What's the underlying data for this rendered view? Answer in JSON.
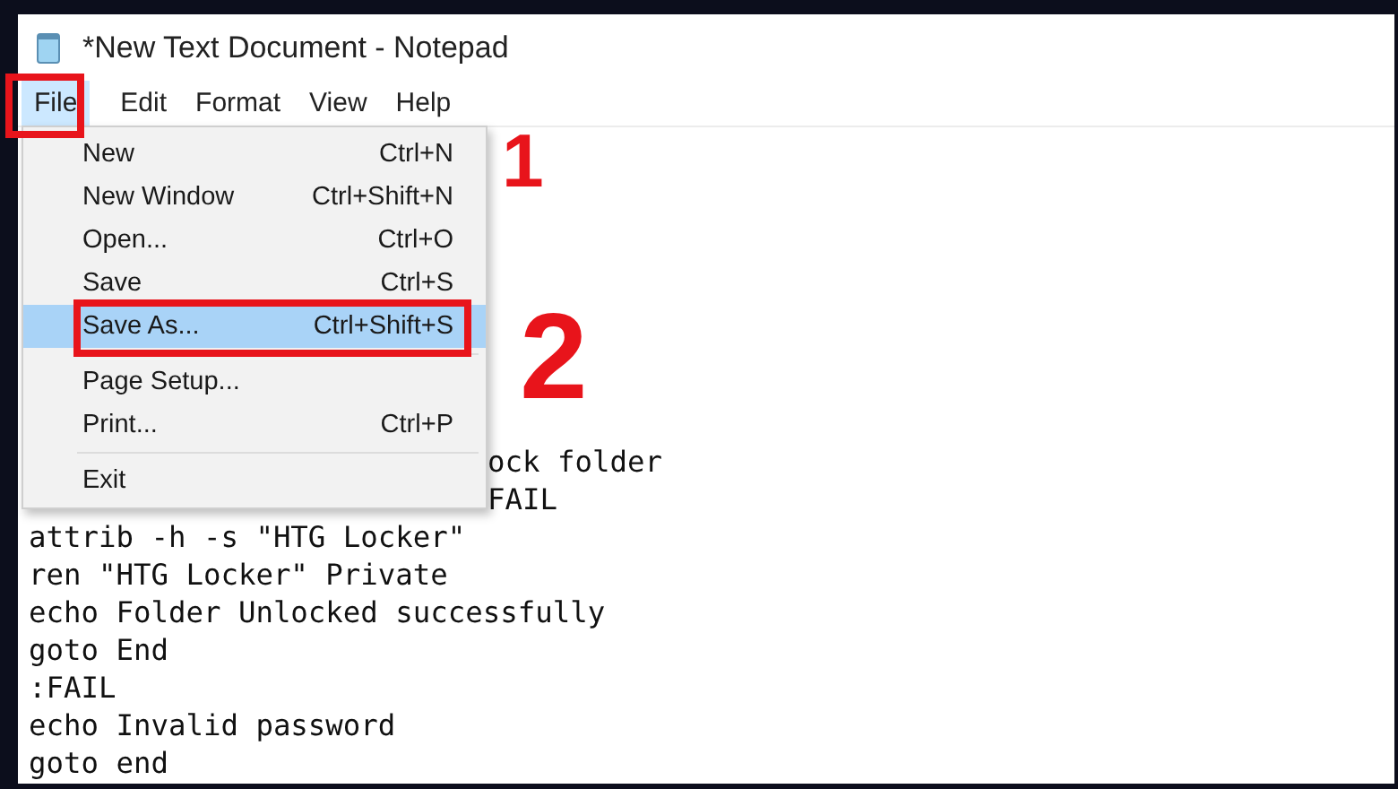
{
  "window": {
    "title": "*New Text Document - Notepad"
  },
  "menu_bar": [
    {
      "label": "File",
      "selected": true
    },
    {
      "label": "Edit",
      "selected": false
    },
    {
      "label": "Format",
      "selected": false
    },
    {
      "label": "View",
      "selected": false
    },
    {
      "label": "Help",
      "selected": false
    }
  ],
  "file_menu": [
    {
      "kind": "item",
      "label": "New",
      "shortcut": "Ctrl+N",
      "selected": false
    },
    {
      "kind": "item",
      "label": "New Window",
      "shortcut": "Ctrl+Shift+N",
      "selected": false
    },
    {
      "kind": "item",
      "label": "Open...",
      "shortcut": "Ctrl+O",
      "selected": false
    },
    {
      "kind": "item",
      "label": "Save",
      "shortcut": "Ctrl+S",
      "selected": false
    },
    {
      "kind": "item",
      "label": "Save As...",
      "shortcut": "Ctrl+Shift+S",
      "selected": true
    },
    {
      "kind": "separator"
    },
    {
      "kind": "item",
      "label": "Page Setup...",
      "selected": false
    },
    {
      "kind": "item",
      "label": "Print...",
      "shortcut": "Ctrl+P",
      "selected": false
    },
    {
      "kind": "separator"
    },
    {
      "kind": "item",
      "label": "Exit",
      "selected": false
    }
  ],
  "editor_lines": [
    {
      "kind": "clipped",
      "text": "ock folder"
    },
    {
      "kind": "clipped",
      "text": "FAIL"
    },
    {
      "kind": "full",
      "text": "attrib -h -s \"HTG Locker\""
    },
    {
      "kind": "full",
      "text": "ren \"HTG Locker\" Private"
    },
    {
      "kind": "full",
      "text": "echo Folder Unlocked successfully"
    },
    {
      "kind": "full",
      "text": "goto End"
    },
    {
      "kind": "full",
      "text": ":FAIL"
    },
    {
      "kind": "full",
      "text": "echo Invalid password"
    },
    {
      "kind": "full",
      "text": "goto end"
    }
  ],
  "step_labels": [
    "1",
    "2"
  ]
}
